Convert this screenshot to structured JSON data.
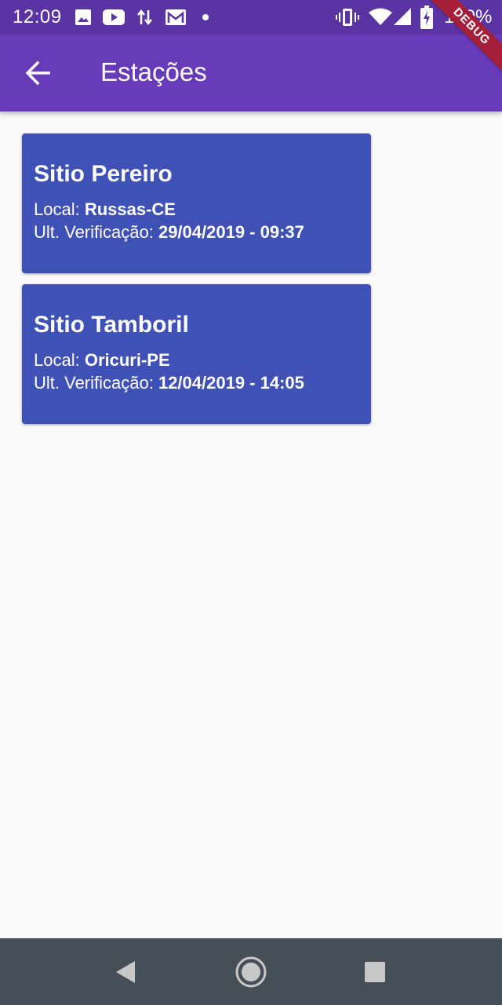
{
  "status_bar": {
    "time": "12:09",
    "battery": "100%",
    "icons": [
      "image-icon",
      "youtube-icon",
      "data-transfer-icon",
      "gmail-icon",
      "notification-dot-icon",
      "vibrate-icon",
      "wifi-icon",
      "signal-icon",
      "battery-charging-icon"
    ]
  },
  "debug_banner": "DEBUG",
  "app_bar": {
    "title": "Estações",
    "back_icon": "arrow-back-icon"
  },
  "stations": [
    {
      "name": "Sitio Pereiro",
      "local_label": "Local: ",
      "local_value": "Russas-CE",
      "verification_label": "Ult. Verificação: ",
      "verification_value": "29/04/2019 - 09:37"
    },
    {
      "name": "Sitio Tamboril",
      "local_label": "Local: ",
      "local_value": "Oricuri-PE",
      "verification_label": "Ult. Verificação: ",
      "verification_value": "12/04/2019 - 14:05"
    }
  ],
  "nav_bar": {
    "buttons": [
      "back-triangle-icon",
      "home-circle-icon",
      "recents-square-icon"
    ]
  },
  "colors": {
    "status_bar": "#5a34a3",
    "app_bar": "#673ab7",
    "card": "#3f51b5",
    "background": "#fafafa",
    "nav_bar": "#474f56",
    "debug_banner": "#a51f38"
  }
}
